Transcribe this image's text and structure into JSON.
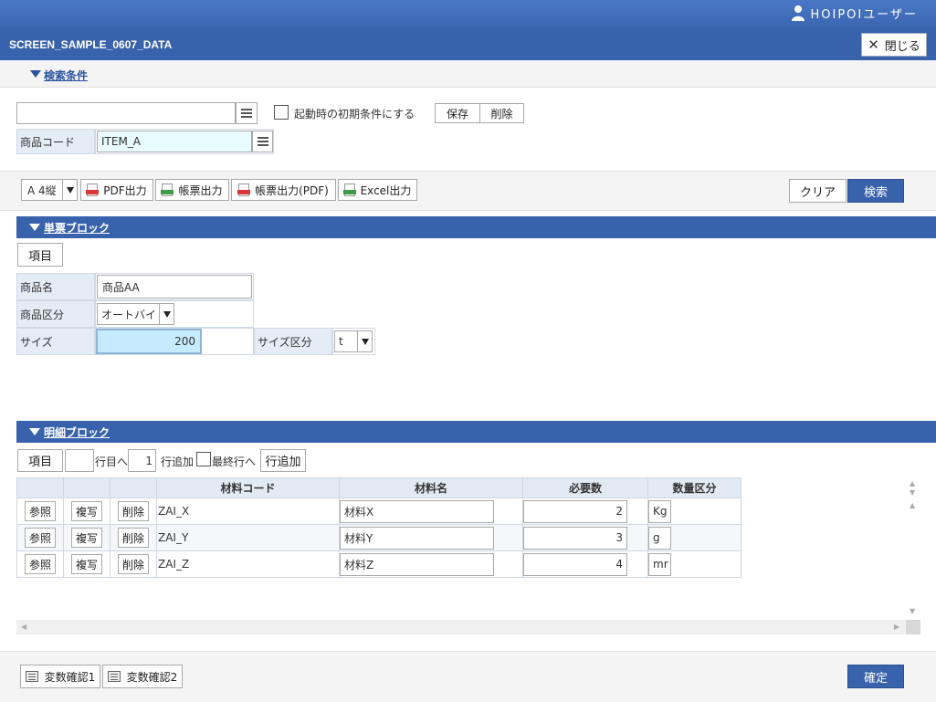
{
  "header": {
    "user_name": "HOIPOIユーザー",
    "screen_title": "SCREEN_SAMPLE_0607_DATA",
    "close_label": "閉じる"
  },
  "search_conditions": {
    "section_title": "検索条件",
    "condition_name_value": "",
    "startup_checkbox_label": "起動時の初期条件にする",
    "startup_checked": false,
    "save_label": "保存",
    "delete_label": "削除",
    "product_code_label": "商品コード",
    "product_code_value": "ITEM_A"
  },
  "toolbar": {
    "paper_size": "A 4縦",
    "pdf_output": "PDF出力",
    "report_output": "帳票出力",
    "report_pdf_output": "帳票出力(PDF)",
    "excel_output": "Excel出力",
    "clear_label": "クリア",
    "search_label": "検索"
  },
  "single_block": {
    "title": "単票ブロック",
    "item_button": "項目",
    "product_name_label": "商品名",
    "product_name_value": "商品AA",
    "product_type_label": "商品区分",
    "product_type_value": "オートバイ",
    "size_label": "サイズ",
    "size_value": "200",
    "size_type_label": "サイズ区分",
    "size_type_value": "t"
  },
  "detail_block": {
    "title": "明細ブロック",
    "item_button": "項目",
    "goto_row_value": "",
    "goto_row_label": "行目へ",
    "add_count_value": "1",
    "add_row_label": "行追加",
    "last_row_label": "最終行へ",
    "last_row_checked": false,
    "add_row_button": "行追加",
    "columns": [
      "",
      "",
      "",
      "材料コード",
      "材料名",
      "必要数",
      "数量区分"
    ],
    "row_buttons": {
      "ref": "参照",
      "copy": "複写",
      "delete": "削除"
    },
    "rows": [
      {
        "code": "ZAI_X",
        "name": "材料X",
        "qty": "2",
        "unit": "Kg"
      },
      {
        "code": "ZAI_Y",
        "name": "材料Y",
        "qty": "3",
        "unit": "g"
      },
      {
        "code": "ZAI_Z",
        "name": "材料Z",
        "qty": "4",
        "unit": "mr"
      }
    ]
  },
  "footer": {
    "var_check_1": "変数確認1",
    "var_check_2": "変数確認2",
    "confirm_label": "確定"
  }
}
